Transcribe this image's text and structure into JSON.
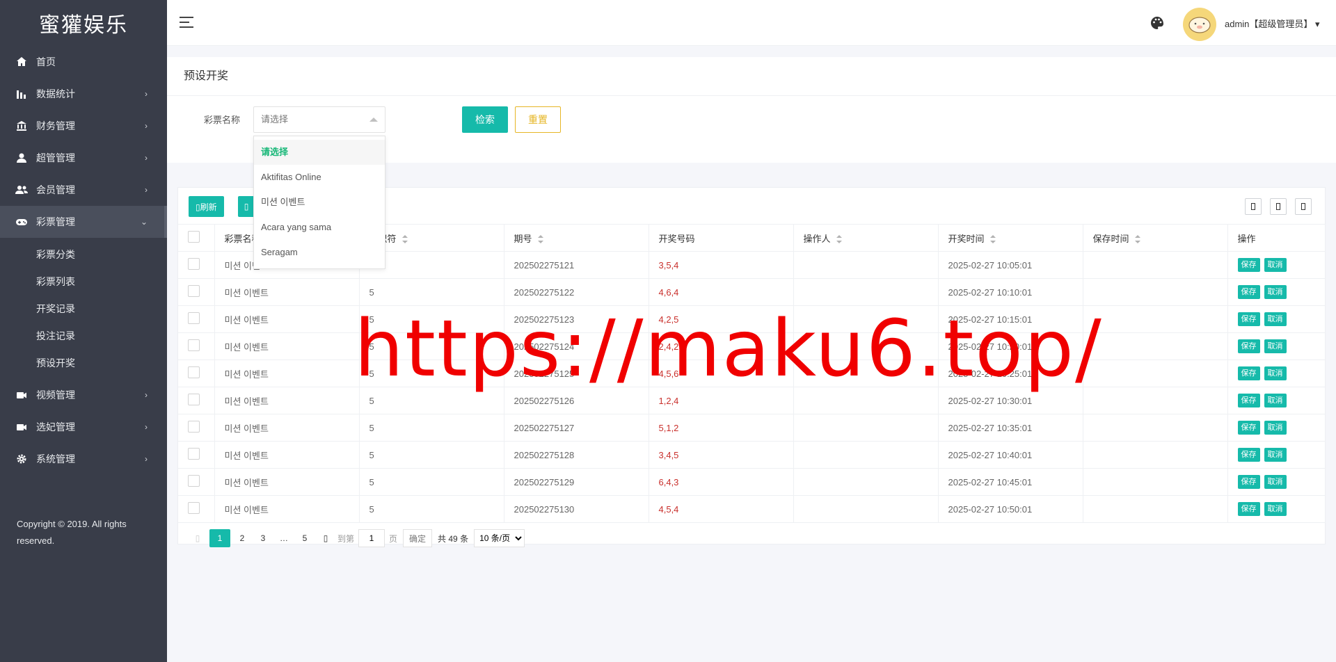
{
  "app": {
    "logo": "蜜獾娱乐"
  },
  "sidebar": {
    "items": [
      {
        "label": "首页",
        "icon": "home-icon",
        "has_arrow": false
      },
      {
        "label": "数据统计",
        "icon": "bar-chart-icon",
        "has_arrow": true
      },
      {
        "label": "财务管理",
        "icon": "bank-icon",
        "has_arrow": true
      },
      {
        "label": "超管管理",
        "icon": "user-icon",
        "has_arrow": true
      },
      {
        "label": "会员管理",
        "icon": "users-icon",
        "has_arrow": true
      },
      {
        "label": "彩票管理",
        "icon": "gamepad-icon",
        "has_arrow": true,
        "expanded": true
      }
    ],
    "submenu": [
      "彩票分类",
      "彩票列表",
      "开奖记录",
      "投注记录",
      "预设开奖"
    ],
    "items_after": [
      {
        "label": "视频管理",
        "icon": "video-icon",
        "has_arrow": true
      },
      {
        "label": "选妃管理",
        "icon": "video-icon",
        "has_arrow": true
      },
      {
        "label": "系统管理",
        "icon": "gear-icon",
        "has_arrow": true
      }
    ],
    "copyright": "Copyright © 2019. All rights reserved."
  },
  "header": {
    "user": "admin【超级管理员】"
  },
  "search": {
    "title": "预设开奖",
    "field_label": "彩票名称",
    "select_placeholder": "请选择",
    "search_btn": "检索",
    "reset_btn": "重置",
    "options": [
      "请选择",
      "Aktifitas Online",
      "미션 이벤트",
      "Acara yang sama",
      "Seragam"
    ]
  },
  "toolbar": {
    "refresh": "刷新"
  },
  "table": {
    "columns": [
      "彩票名称",
      "标识符",
      "期号",
      "开奖号码",
      "操作人",
      "开奖时间",
      "保存时间",
      "操作"
    ],
    "rows": [
      [
        "미션 이벤트",
        "5",
        "202502275121",
        "3,5,4",
        "",
        "2025-02-27 10:05:01",
        ""
      ],
      [
        "미션 이벤트",
        "5",
        "202502275122",
        "4,6,4",
        "",
        "2025-02-27 10:10:01",
        ""
      ],
      [
        "미션 이벤트",
        "5",
        "202502275123",
        "4,2,5",
        "",
        "2025-02-27 10:15:01",
        ""
      ],
      [
        "미션 이벤트",
        "5",
        "202502275124",
        "2,4,2",
        "",
        "2025-02-27 10:20:01",
        ""
      ],
      [
        "미션 이벤트",
        "5",
        "202502275125",
        "4,5,6",
        "",
        "2025-02-27 10:25:01",
        ""
      ],
      [
        "미션 이벤트",
        "5",
        "202502275126",
        "1,2,4",
        "",
        "2025-02-27 10:30:01",
        ""
      ],
      [
        "미션 이벤트",
        "5",
        "202502275127",
        "5,1,2",
        "",
        "2025-02-27 10:35:01",
        ""
      ],
      [
        "미션 이벤트",
        "5",
        "202502275128",
        "3,4,5",
        "",
        "2025-02-27 10:40:01",
        ""
      ],
      [
        "미션 이벤트",
        "5",
        "202502275129",
        "6,4,3",
        "",
        "2025-02-27 10:45:01",
        ""
      ],
      [
        "미션 이벤트",
        "5",
        "202502275130",
        "4,5,4",
        "",
        "2025-02-27 10:50:01",
        ""
      ]
    ],
    "save_label": "保存",
    "cancel_label": "取消"
  },
  "pager": {
    "pages": [
      "1",
      "2",
      "3",
      "…",
      "5"
    ],
    "goto_label": "到第",
    "page_value": "1",
    "page_unit": "页",
    "ok_label": "确定",
    "total": "共 49 条",
    "size": "10 条/页"
  },
  "watermark": "https://maku6.top/"
}
